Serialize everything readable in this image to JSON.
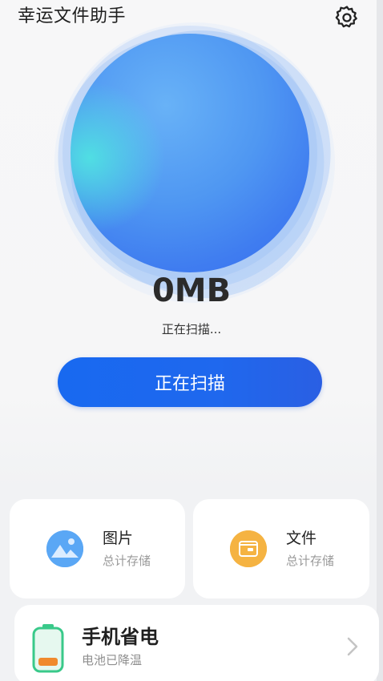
{
  "app": {
    "title": "幸运文件助手"
  },
  "scan": {
    "size": "0MB",
    "status": "正在扫描...",
    "button_label": "正在扫描"
  },
  "categories": [
    {
      "title": "图片",
      "subtitle": "总计存储",
      "icon": "image-icon",
      "color": "#5aa7f5"
    },
    {
      "title": "文件",
      "subtitle": "总计存储",
      "icon": "folder-icon",
      "color": "#f5b342"
    }
  ],
  "battery_card": {
    "title": "手机省电",
    "subtitle": "电池已降温",
    "icon": "battery-icon"
  },
  "colors": {
    "accent": "#1f68ee",
    "orb": "#4f97f2"
  }
}
